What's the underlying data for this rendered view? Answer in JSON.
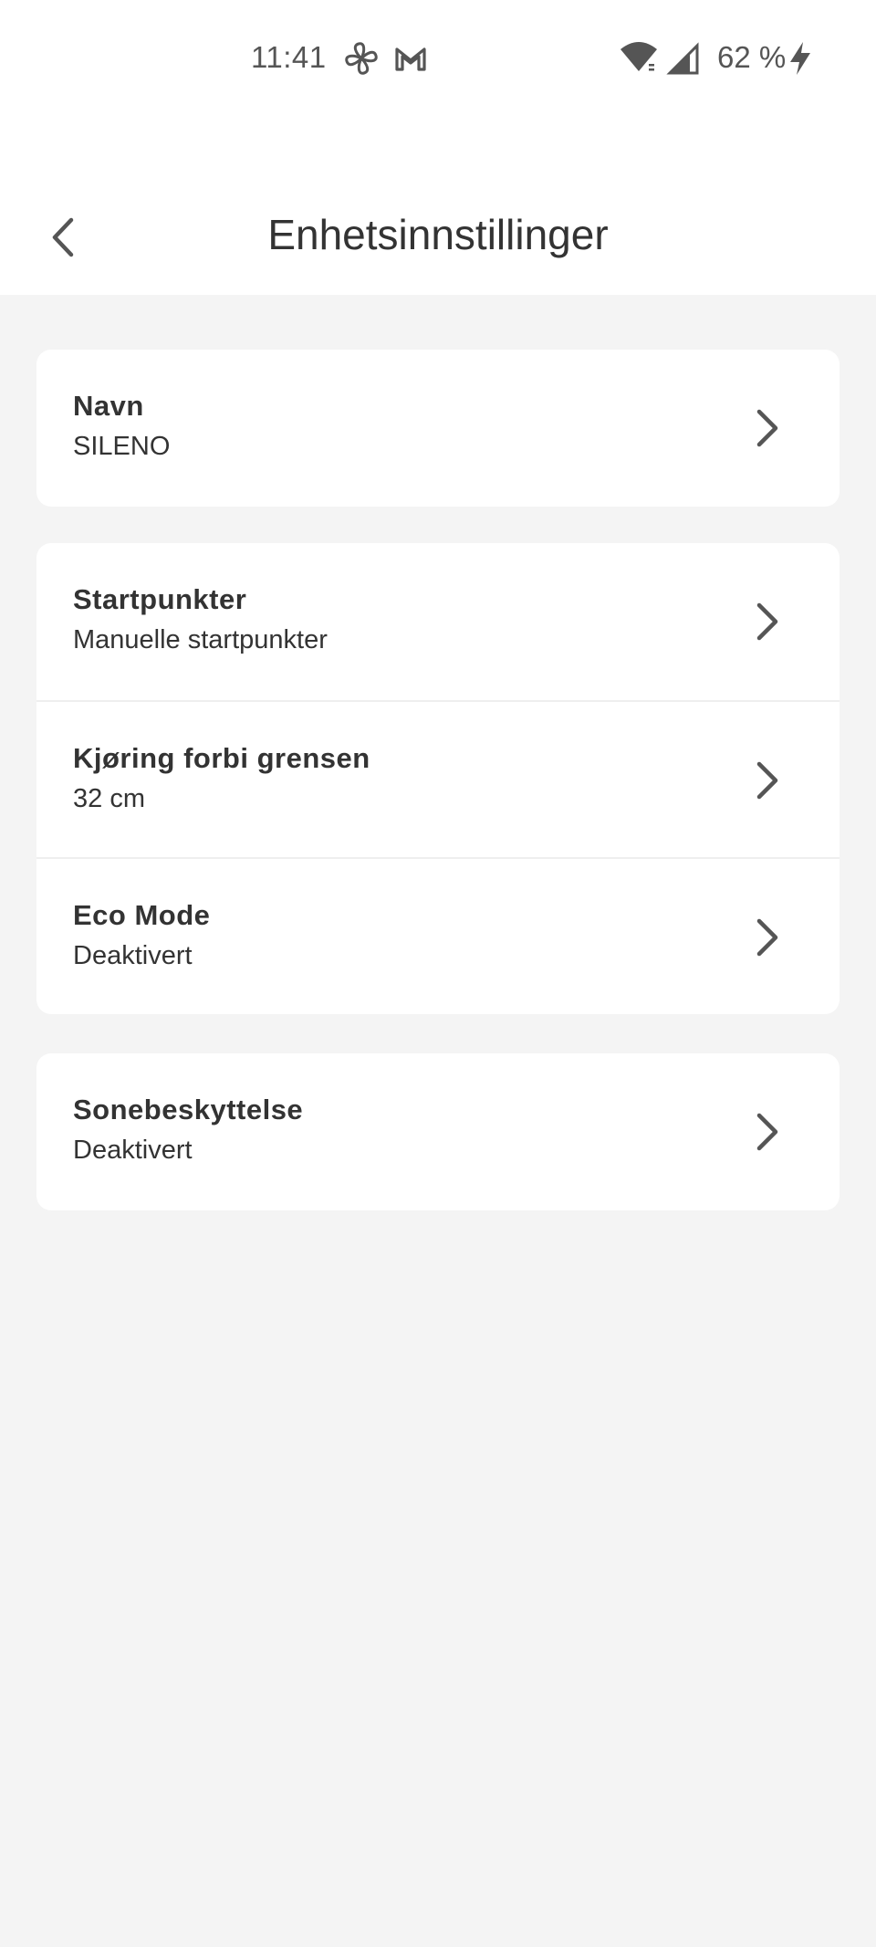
{
  "status_bar": {
    "time": "11:41",
    "battery_text": "62 %",
    "icons": [
      "pinwheel-icon",
      "gmail-icon",
      "wifi-icon",
      "cell-signal-icon",
      "charging-bolt-icon"
    ]
  },
  "header": {
    "title": "Enhetsinnstillinger",
    "back_icon": "chevron-left-icon"
  },
  "groups": [
    {
      "items": [
        {
          "title": "Navn",
          "value": "SILENO"
        }
      ]
    },
    {
      "items": [
        {
          "title": "Startpunkter",
          "value": "Manuelle startpunkter"
        },
        {
          "title": "Kjøring forbi grensen",
          "value": "32 cm"
        },
        {
          "title": "Eco Mode",
          "value": "Deaktivert"
        }
      ]
    },
    {
      "items": [
        {
          "title": "Sonebeskyttelse",
          "value": "Deaktivert"
        }
      ]
    }
  ],
  "colors": {
    "background": "#f4f4f4",
    "card": "#ffffff",
    "text": "#333333",
    "icon": "#555555"
  }
}
